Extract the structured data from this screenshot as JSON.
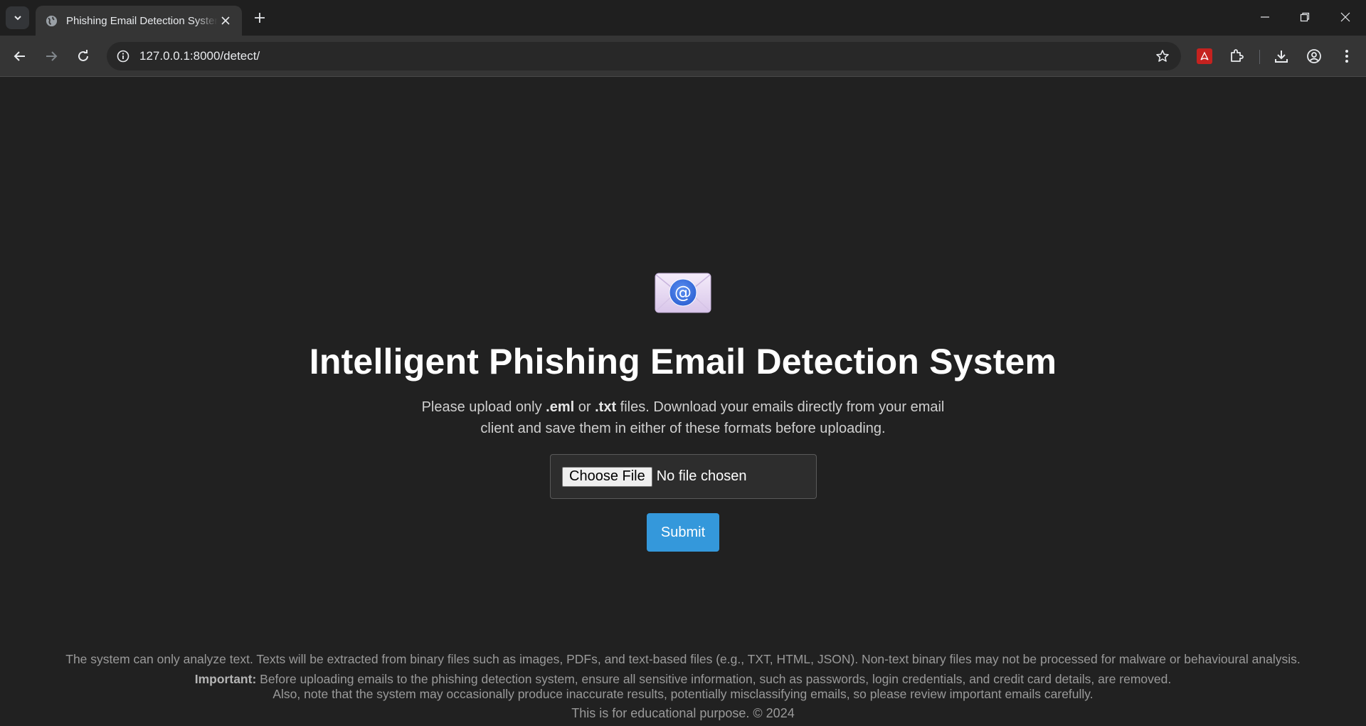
{
  "browser": {
    "tab_title": "Phishing Email Detection System",
    "url": "127.0.0.1:8000/detect/"
  },
  "page": {
    "title": "Intelligent Phishing Email Detection System",
    "desc_part1": "Please upload only ",
    "desc_ext1": ".eml",
    "desc_part2": " or ",
    "desc_ext2": ".txt",
    "desc_part3": " files. Download your emails directly from your email client and save them in either of these formats before uploading.",
    "choose_file_label": "Choose File",
    "file_status": "No file chosen",
    "submit_label": "Submit"
  },
  "footer": {
    "line1": "The system can only analyze text. Texts will be extracted from binary files such as images, PDFs, and text-based files (e.g., TXT, HTML, JSON). Non-text binary files may not be processed for malware or behavioural analysis.",
    "important_label": "Important:",
    "line2": " Before uploading emails to the phishing detection system, ensure all sensitive information, such as passwords, login credentials, and credit card details, are removed.",
    "line3": "Also, note that the system may occasionally produce inaccurate results, potentially misclassifying emails, so please review important emails carefully.",
    "line4": "This is for educational purpose. © 2024"
  },
  "colors": {
    "background": "#212121",
    "submit": "#3498db",
    "title": "#ffffff"
  },
  "icons": [
    "tab-search-icon",
    "globe-icon",
    "close-icon",
    "plus-icon",
    "minimize-icon",
    "restore-icon",
    "window-close-icon",
    "back-icon",
    "forward-icon",
    "reload-icon",
    "site-info-icon",
    "star-icon",
    "pdf-extension-icon",
    "extensions-icon",
    "download-icon",
    "profile-icon",
    "menu-icon",
    "email-envelope-icon"
  ]
}
